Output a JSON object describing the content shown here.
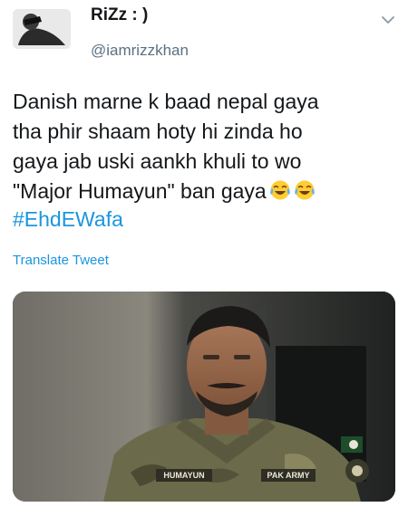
{
  "user": {
    "display_name": "RiZz : )",
    "handle": "@iamrizzkhan"
  },
  "tweet": {
    "text": "Danish marne k baad nepal gaya\ntha phir shaam hoty hi zinda ho\ngaya jab uski aankh khuli to wo\n\"Major Humayun\" ban gaya",
    "emojis": [
      "face-with-tears-of-joy",
      "face-with-tears-of-joy"
    ],
    "hashtag": "#EhdEWafa",
    "translate_label": "Translate Tweet"
  },
  "media": {
    "name_patch": "HUMAYUN",
    "army_patch": "PAK ARMY"
  },
  "colors": {
    "link": "#1b95e0",
    "text": "#14171a",
    "muted": "#5b7083"
  }
}
